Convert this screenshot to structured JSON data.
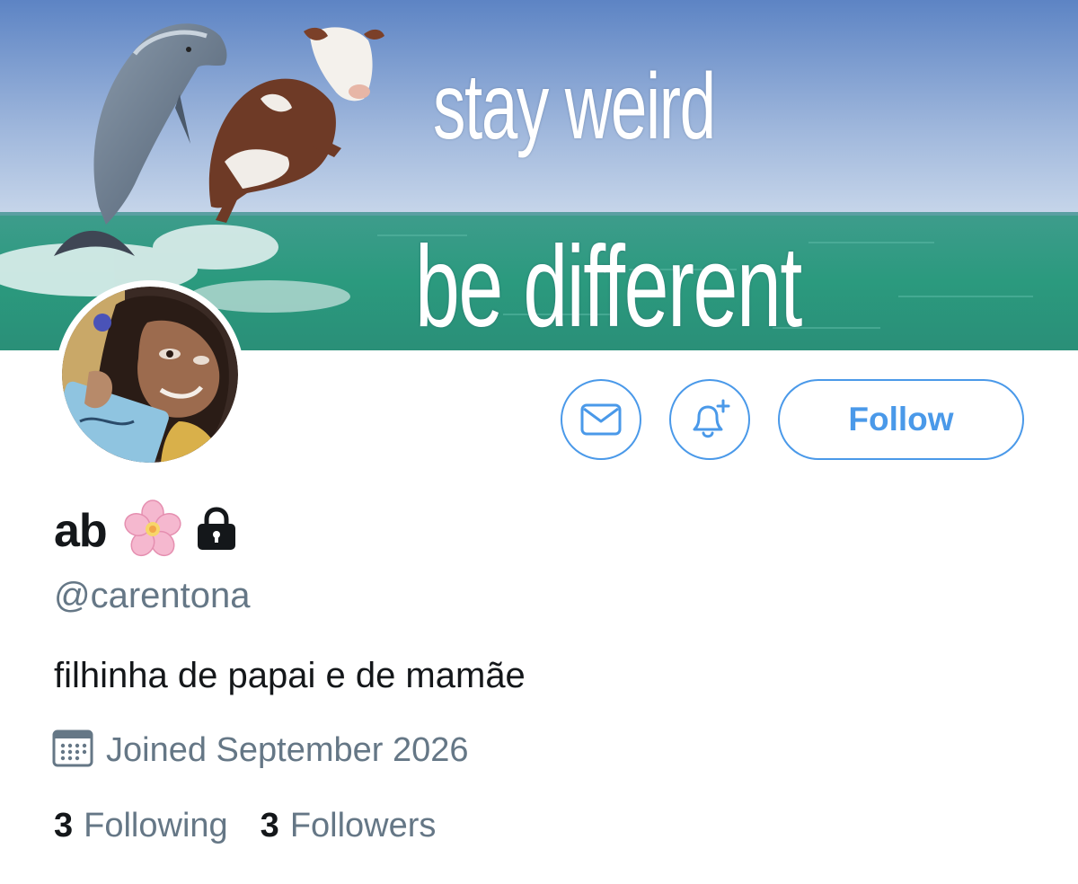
{
  "banner": {
    "line1": "stay weird",
    "line2": "be different"
  },
  "actions": {
    "message_icon": "envelope-icon",
    "notify_icon": "bell-plus-icon",
    "follow_label": "Follow"
  },
  "profile": {
    "display_name": "ab",
    "name_emoji_icon": "cherry-blossom-icon",
    "protected_icon": "lock-icon",
    "handle": "@carentona",
    "bio": "filhinha de papai e de mamãe",
    "joined": "Joined September 2026",
    "joined_icon": "calendar-icon"
  },
  "stats": {
    "following_count": "3",
    "following_label": "Following",
    "followers_count": "3",
    "followers_label": "Followers"
  },
  "colors": {
    "accent": "#4a99e9",
    "text_primary": "#14171a",
    "text_secondary": "#657786",
    "sky": "#7a9ccc",
    "sea": "#2f9a86"
  }
}
